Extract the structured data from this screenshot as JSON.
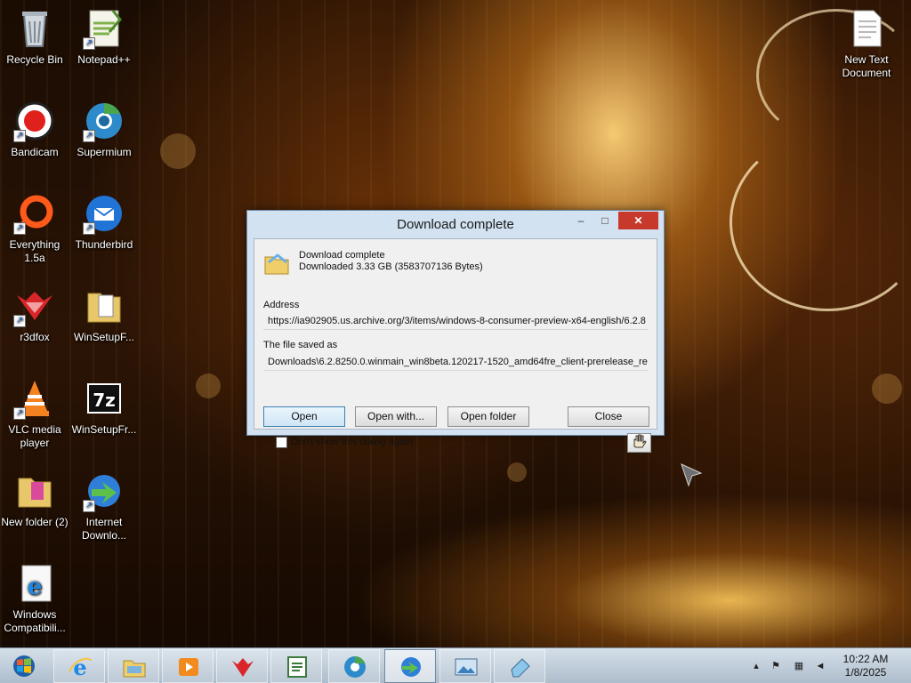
{
  "desktop": {
    "icons": [
      {
        "label": "Recycle Bin",
        "icon": "recycle-bin-icon"
      },
      {
        "label": "Notepad++",
        "icon": "notepad-plus-plus-icon"
      },
      {
        "label": "Bandicam",
        "icon": "bandicam-icon"
      },
      {
        "label": "Supermium",
        "icon": "supermium-icon"
      },
      {
        "label": "Everything 1.5a",
        "icon": "everything-icon"
      },
      {
        "label": "Thunderbird",
        "icon": "thunderbird-icon"
      },
      {
        "label": "r3dfox",
        "icon": "r3dfox-icon"
      },
      {
        "label": "WinSetupF...",
        "icon": "folder-icon"
      },
      {
        "label": "VLC media player",
        "icon": "vlc-icon"
      },
      {
        "label": "WinSetupFr...",
        "icon": "7zip-icon"
      },
      {
        "label": "New folder (2)",
        "icon": "folder-icon"
      },
      {
        "label": "Internet Downlo...",
        "icon": "internet-download-manager-icon"
      },
      {
        "label": "Windows Compatibili...",
        "icon": "internet-explorer-icon"
      },
      {
        "label": "New Text Document",
        "icon": "text-document-icon"
      }
    ]
  },
  "dialog": {
    "title": "Download complete",
    "status_line1": "Download complete",
    "status_line2": "Downloaded 3.33  GB (3583707136 Bytes)",
    "address_label": "Address",
    "address_value": "https://ia902905.us.archive.org/3/items/windows-8-consumer-preview-x64-english/6.2.8",
    "saved_label": "The file saved as",
    "saved_value": "Downloads\\6.2.8250.0.winmain_win8beta.120217-1520_amd64fre_client-prerelease_re",
    "buttons": {
      "open": "Open",
      "open_with": "Open with...",
      "open_folder": "Open folder",
      "close": "Close"
    },
    "dont_show_label": "Don't show this dialog again",
    "dont_show_checked": false,
    "titlebar": {
      "minimize": "–",
      "maximize": "□",
      "close": "✕"
    }
  },
  "taskbar": {
    "items": [
      {
        "icon": "internet-explorer-icon"
      },
      {
        "icon": "file-explorer-icon"
      },
      {
        "icon": "media-player-icon"
      },
      {
        "icon": "r3dfox-icon"
      },
      {
        "icon": "notepad-icon"
      },
      {
        "icon": "supermium-icon"
      },
      {
        "icon": "internet-download-manager-icon",
        "active": true
      },
      {
        "icon": "image-viewer-icon"
      },
      {
        "icon": "eraser-icon"
      }
    ],
    "tray": {
      "expand": "▴",
      "flag": "⚑",
      "network": "▦",
      "volume": "◄"
    },
    "clock": {
      "time": "10:22 AM",
      "date": "1/8/2025"
    }
  }
}
